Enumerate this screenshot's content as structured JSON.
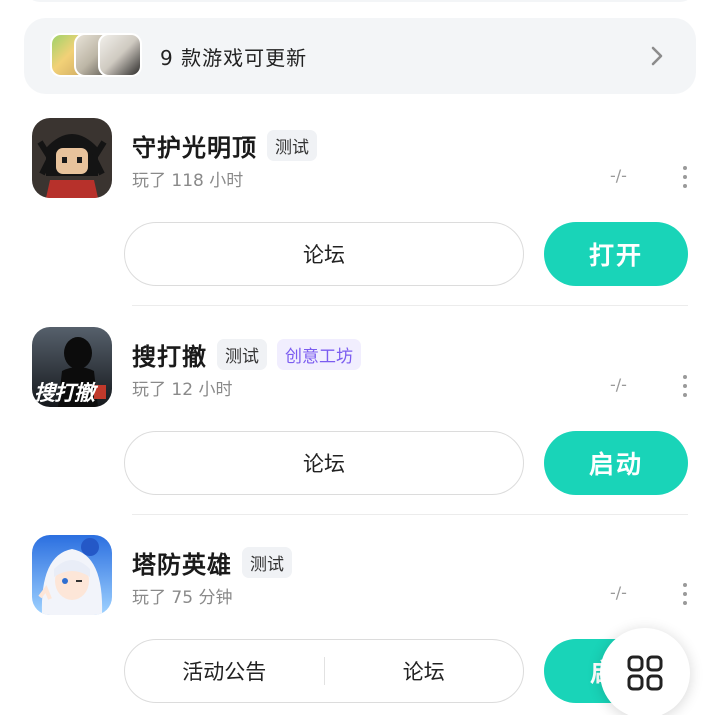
{
  "update_banner": {
    "text": "9 款游戏可更新",
    "icons": [
      "game-thumb-icon",
      "game-thumb-icon",
      "game-thumb-icon"
    ]
  },
  "games": [
    {
      "name": "守护光明顶",
      "tags": [
        "测试"
      ],
      "playtime": "玩了 118 小时",
      "rating": "-/-",
      "secondary_actions": [
        "论坛"
      ],
      "primary_action": "打开"
    },
    {
      "name": "搜打撤",
      "tags": [
        "测试",
        "创意工坊"
      ],
      "icon_text": "搜打撤",
      "playtime": "玩了 12 小时",
      "rating": "-/-",
      "secondary_actions": [
        "论坛"
      ],
      "primary_action": "启动"
    },
    {
      "name": "塔防英雄",
      "tags": [
        "测试"
      ],
      "playtime": "玩了 75 分钟",
      "rating": "-/-",
      "secondary_actions": [
        "活动公告",
        "论坛"
      ],
      "primary_action": "启"
    }
  ],
  "colors": {
    "accent": "#19d4b8",
    "purple_tag": "#7b5cf0",
    "banner_bg": "#f3f5f7"
  },
  "fab": {
    "icon": "grid-icon"
  }
}
